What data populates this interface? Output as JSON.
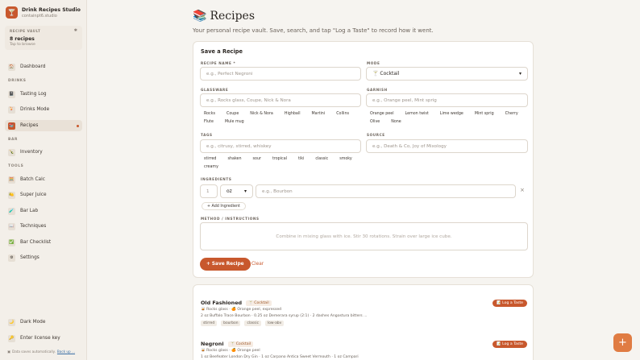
{
  "app": {
    "name": "Drink Recipes Studio",
    "subtitle": "containpt6.studio",
    "logo_icon": "🍸"
  },
  "vault": {
    "label": "RECIPE VAULT",
    "count": "8 recipes",
    "hint": "Tap to browse",
    "pin_icon": "✱"
  },
  "sidebar": {
    "dashboard": {
      "label": "Dashboard",
      "icon": "🏠"
    },
    "section_drinks": "DRINKS",
    "tasting_log": {
      "label": "Tasting Log",
      "icon": "📓"
    },
    "drinks_mode": {
      "label": "Drinks Mode",
      "icon": "🍹"
    },
    "recipes": {
      "label": "Recipes",
      "icon": "📚"
    },
    "section_bar": "BAR",
    "inventory": {
      "label": "Inventory",
      "icon": "🍾"
    },
    "section_tools": "TOOLS",
    "batch_calc": {
      "label": "Batch Calc",
      "icon": "🧮"
    },
    "super_juice": {
      "label": "Super Juice",
      "icon": "🍋"
    },
    "bar_lab": {
      "label": "Bar Lab",
      "icon": "🧪"
    },
    "techniques": {
      "label": "Techniques",
      "icon": "📖"
    },
    "bar_checklist": {
      "label": "Bar Checklist",
      "icon": "✅"
    },
    "settings": {
      "label": "Settings",
      "icon": "⚙"
    },
    "dark_mode": {
      "label": "Dark Mode",
      "icon": "🌙"
    },
    "license": {
      "label": "Enter license key",
      "icon": "🔑"
    },
    "footer_note": "Data saves automatically.",
    "footer_link": "Back up ..."
  },
  "page": {
    "title": "Recipes",
    "title_icon": "📚",
    "subtitle": "Your personal recipe vault. Save, search, and tap \"Log a Taste\" to record how it went."
  },
  "form": {
    "heading": "Save a Recipe",
    "name_label": "RECIPE NAME *",
    "name_placeholder": "e.g., Perfect Negroni",
    "mode_label": "MODE",
    "mode_value": "🍸 Cocktail",
    "glass_label": "GLASSWARE",
    "glass_placeholder": "e.g., Rocks glass, Coupe, Nick & Nora",
    "glass_options": [
      "Rocks",
      "Coupe",
      "Nick & Nora",
      "Highball",
      "Martini",
      "Collins",
      "Flute",
      "Mule mug"
    ],
    "garnish_label": "GARNISH",
    "garnish_placeholder": "e.g., Orange peel, Mint sprig",
    "garnish_options": [
      "Orange peel",
      "Lemon twist",
      "Lime wedge",
      "Mint sprig",
      "Cherry",
      "Olive",
      "None"
    ],
    "tags_label": "TAGS",
    "tags_placeholder": "e.g., citrusy, stirred, whiskey",
    "tag_options": [
      "stirred",
      "shaken",
      "sour",
      "tropical",
      "tiki",
      "classic",
      "smoky",
      "creamy"
    ],
    "source_label": "SOURCE",
    "source_placeholder": "e.g., Death & Co, Joy of Mixology",
    "ingredients_label": "INGREDIENTS",
    "qty_placeholder": "1",
    "unit_value": "oz",
    "ingredient_placeholder": "e.g., Bourbon",
    "remove_icon": "×",
    "add_ingredient": "+ Add Ingredient",
    "method_label": "METHOD / INSTRUCTIONS",
    "method_placeholder": "Combine in mixing glass with ice. Stir 30 rotations. Strain over large ice cube.",
    "save_button": "+ Save Recipe",
    "clear_button": "Clear"
  },
  "recipes": [
    {
      "name": "Old Fashioned",
      "mode": "🍸 Cocktail",
      "meta": "🥃 Rocks glass · 🍊 Orange peel, expressed",
      "ingredients": "2 oz Buffalo Trace Bourbon · 0.25 oz Demerara syrup (2:1) · 2 dashes Angostura bitters ...",
      "tags": [
        "stirred",
        "bourbon",
        "classic",
        "low-abv"
      ],
      "action": "📝 Log a Taste"
    },
    {
      "name": "Negroni",
      "mode": "🍸 Cocktail",
      "meta": "🥃 Rocks glass · 🍊 Orange peel",
      "ingredients": "1 oz Beefeater London Dry Gin · 1 oz Carpano Antica Sweet Vermouth · 1 oz Campari",
      "tags": [],
      "action": "📝 Log a Taste"
    }
  ],
  "fab_icon": "+"
}
